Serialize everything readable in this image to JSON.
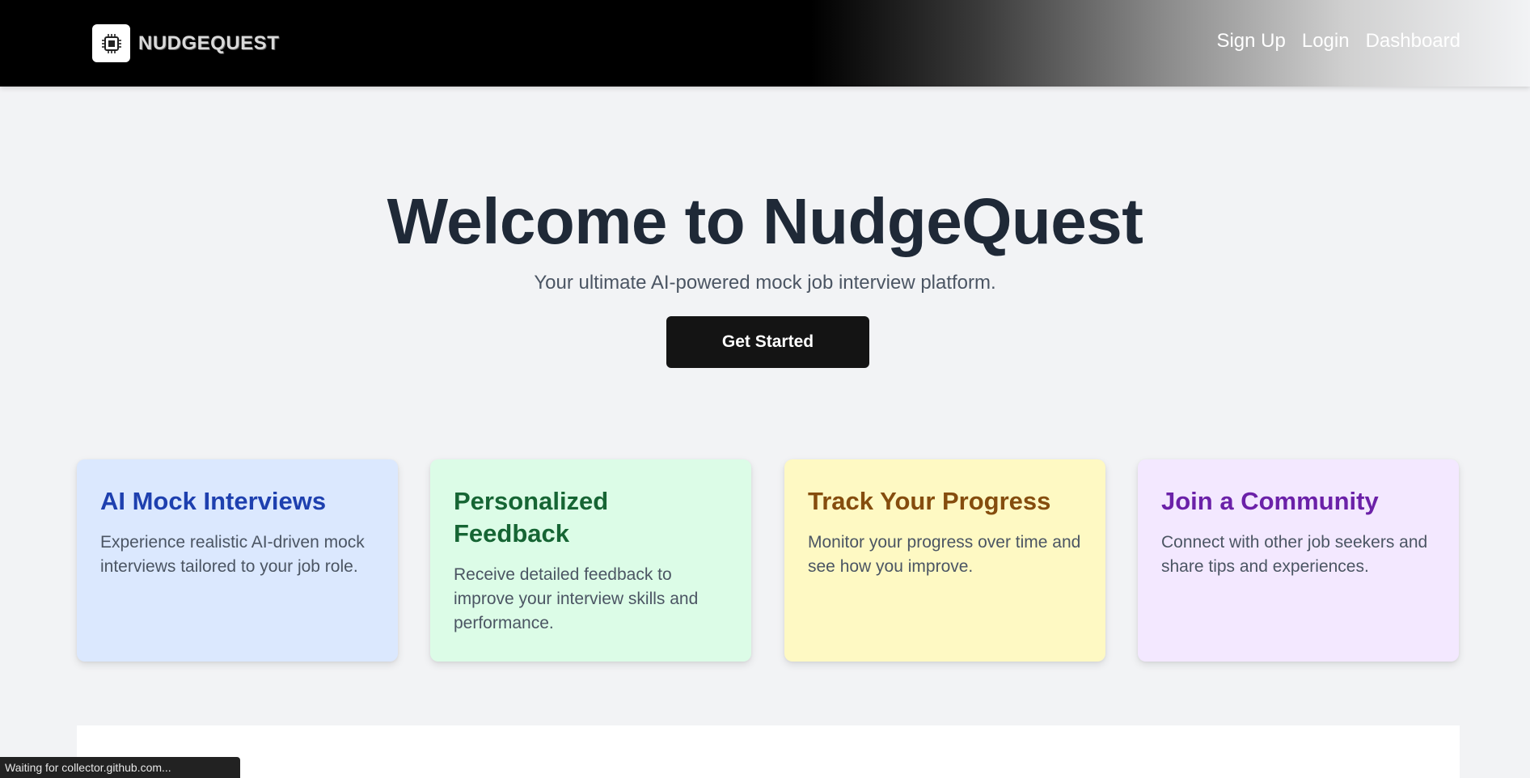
{
  "nav": {
    "brand": "NUDGEQUEST",
    "links": [
      "Sign Up",
      "Login",
      "Dashboard"
    ]
  },
  "hero": {
    "title": "Welcome to NudgeQuest",
    "subtitle": "Your ultimate AI-powered mock job interview platform.",
    "cta_label": "Get Started"
  },
  "features": [
    {
      "title": "AI Mock Interviews",
      "description": "Experience realistic AI-driven mock interviews tailored to your job role.",
      "accent": "#1e40af",
      "background": "#dbe8fe"
    },
    {
      "title": "Personalized Feedback",
      "description": "Receive detailed feedback to improve your interview skills and performance.",
      "accent": "#166534",
      "background": "#dcfce7"
    },
    {
      "title": "Track Your Progress",
      "description": "Monitor your progress over time and see how you improve.",
      "accent": "#854d0e",
      "background": "#fef9c3"
    },
    {
      "title": "Join a Community",
      "description": "Connect with other job seekers and share tips and experiences.",
      "accent": "#6b21a8",
      "background": "#f3e8ff"
    }
  ],
  "status_bar": "Waiting for collector.github.com...",
  "icons": {
    "logo": "cpu-chip-icon"
  }
}
